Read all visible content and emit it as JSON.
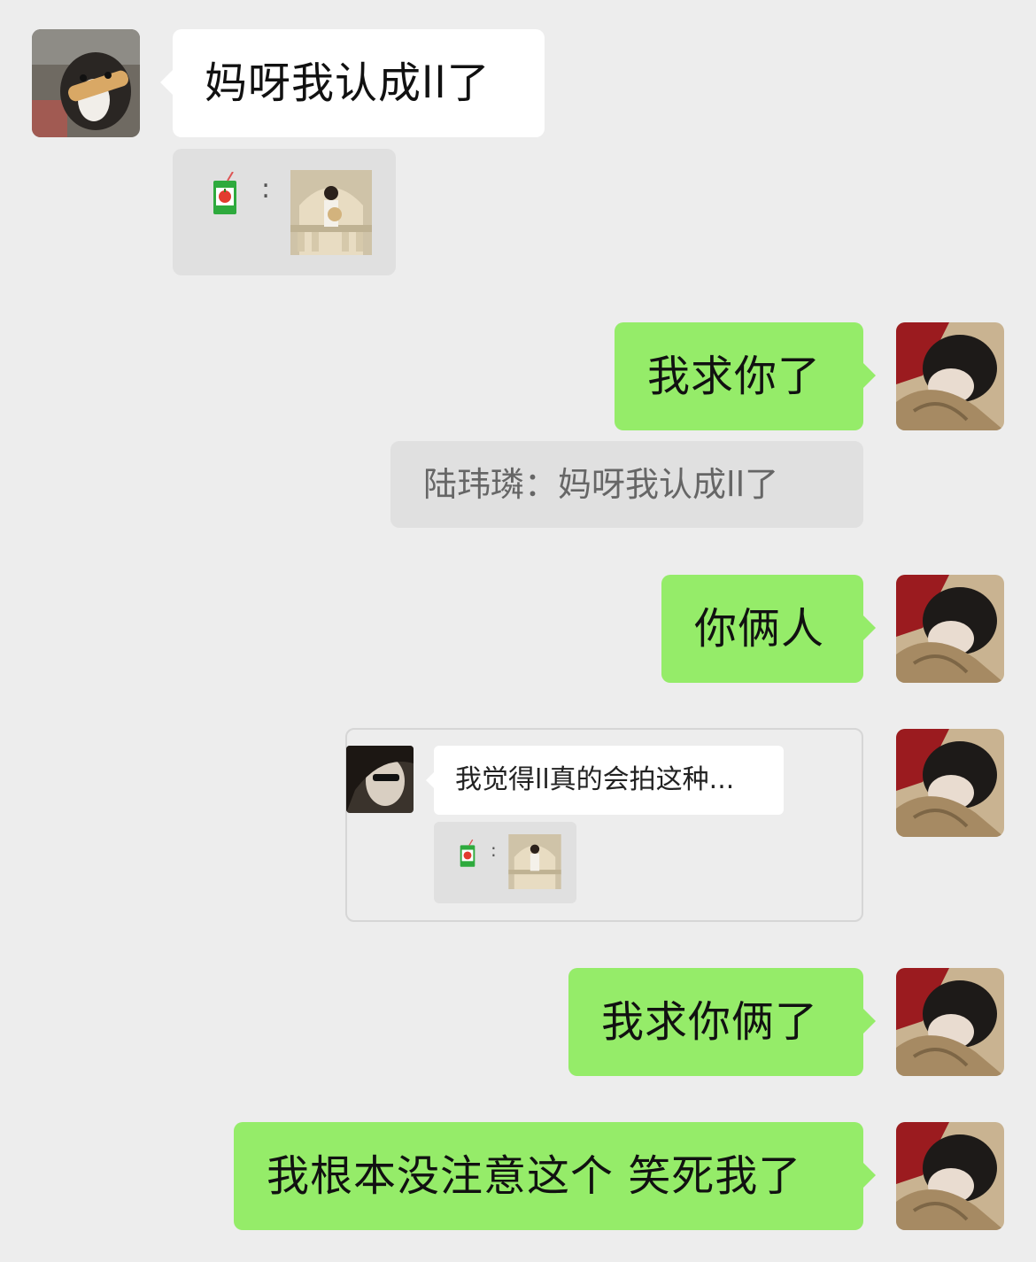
{
  "messages": [
    {
      "sender": "other",
      "text": "妈呀我认成ll了"
    },
    {
      "sender": "other",
      "type": "image",
      "colon": ":"
    },
    {
      "sender": "me",
      "text": "我求你了"
    },
    {
      "sender": "me",
      "type": "quote",
      "quote_author": "陆玮璘",
      "quote_separator": "：",
      "quote_text": "妈呀我认成ll了"
    },
    {
      "sender": "me",
      "text": "你俩人"
    },
    {
      "sender": "me",
      "type": "chat-record",
      "record_text": "我觉得ll真的会拍这种...",
      "record_colon": ":"
    },
    {
      "sender": "me",
      "text": "我求你俩了"
    },
    {
      "sender": "me",
      "text": "我根本没注意这个 笑死我了"
    }
  ],
  "colors": {
    "background": "#ededed",
    "bubble_me": "#95ec69",
    "bubble_other": "#ffffff",
    "quote_bg": "#e0e0e0"
  },
  "icons": {
    "juice_box": "juice-box-icon",
    "avatar_other": "dog-avatar",
    "avatar_me": "person-sleeping-avatar"
  }
}
